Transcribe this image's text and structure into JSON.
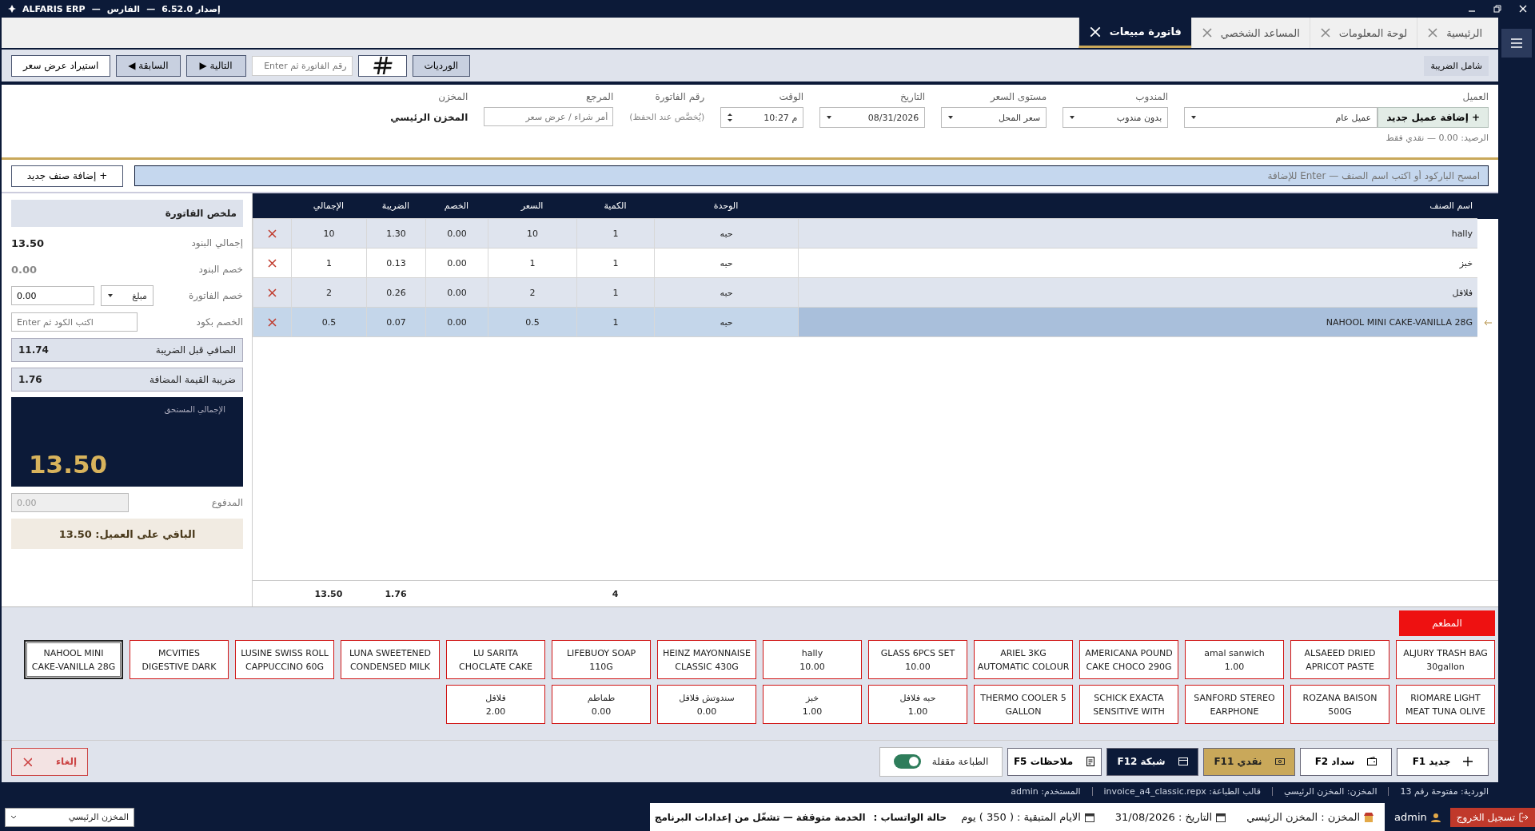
{
  "title_bar": {
    "title_parts": [
      "إصدار 6.52.0",
      "—",
      "الفارس",
      "—",
      "ALFARIS ERP"
    ]
  },
  "tabs": [
    {
      "label": "الرئيسية",
      "selected": false
    },
    {
      "label": "لوحة المعلومات",
      "selected": false
    },
    {
      "label": "المساعد الشخصي",
      "selected": false
    },
    {
      "label": "فاتورة مبيعات",
      "selected": true
    }
  ],
  "toolbar": {
    "tax_inclusive": "شامل الضريبة",
    "shifts": "الورديات",
    "invoice_search_placeholder": "رقم الفاتورة ثم Enter",
    "next": {
      "label": "التالية",
      "glyph": "▶"
    },
    "previous": {
      "label": "السابقة",
      "glyph": "◀"
    },
    "import_quote": "استيراد عرض سعر"
  },
  "form": {
    "customer": {
      "label": "العميل",
      "add_button": "+ إضافة عميل جديد",
      "value": "عميل عام",
      "balance": "الرصيد: 0.00 — نقدي فقط"
    },
    "fields": [
      {
        "kind": "select",
        "label": "المندوب",
        "value": "بدون مندوب"
      },
      {
        "kind": "select",
        "label": "مستوى السعر",
        "value": "سعر المحل"
      },
      {
        "kind": "select",
        "label": "التاريخ",
        "value": "08/31/2026"
      },
      {
        "kind": "spinner",
        "label": "الوقت",
        "value": "10:27 م"
      },
      {
        "kind": "note",
        "label": "رقم الفاتورة",
        "value": "(يُخصَّص عند الحفظ)"
      },
      {
        "kind": "input",
        "label": "المرجع",
        "placeholder": "أمر شراء / عرض سعر"
      },
      {
        "kind": "text",
        "label": "المخزن",
        "value": "المخزن الرئيسي"
      }
    ]
  },
  "search": {
    "placeholder": "امسح الباركود أو اكتب اسم الصنف — Enter للإضافة",
    "add_item": "+ إضافة صنف جديد"
  },
  "table": {
    "columns": [
      "اسم الصنف",
      "الوحدة",
      "الكمية",
      "السعر",
      "الخصم",
      "الضريبة",
      "الإجمالي"
    ],
    "rows": [
      {
        "cells": [
          "hally",
          "حبه",
          "1",
          "10",
          "0.00",
          "1.30",
          "10"
        ],
        "selected": false
      },
      {
        "cells": [
          "خبز",
          "حبه",
          "1",
          "1",
          "0.00",
          "0.13",
          "1"
        ],
        "selected": false
      },
      {
        "cells": [
          "فلافل",
          "حبه",
          "1",
          "2",
          "0.00",
          "0.26",
          "2"
        ],
        "selected": false
      },
      {
        "cells": [
          "NAHOOL MINI CAKE-VANILLA 28G",
          "حبه",
          "1",
          "0.5",
          "0.00",
          "0.07",
          "0.5"
        ],
        "selected": true
      }
    ],
    "totals": {
      "quantity": "4",
      "tax": "1.76",
      "total": "13.50"
    }
  },
  "summary": {
    "title": "ملخص الفاتورة",
    "lines": [
      {
        "kind": "value",
        "label": "إجمالي البنود",
        "value": "13.50"
      },
      {
        "kind": "muted",
        "label": "خصم البنود",
        "value": "0.00"
      },
      {
        "kind": "discount",
        "label": "خصم الفاتورة",
        "type": "مبلغ",
        "value": "0.00"
      },
      {
        "kind": "code",
        "label": "الخصم بكود",
        "placeholder": "اكتب الكود ثم Enter"
      },
      {
        "kind": "boxed",
        "label": "الصافي قبل الضريبة",
        "value": "11.74"
      },
      {
        "kind": "boxed",
        "label": "ضريبة القيمة المضافة",
        "value": "1.76"
      },
      {
        "kind": "grand",
        "label": "الإجمالي المستحق",
        "value": "13.50"
      },
      {
        "kind": "paid",
        "label": "المدفوع",
        "value": "0.00"
      },
      {
        "kind": "remaining",
        "label": "الباقي على العميل: 13.50"
      }
    ]
  },
  "products": {
    "category": "المطعم",
    "items": [
      {
        "lines": [
          "ALJURY TRASH BAG",
          "30gallon"
        ],
        "selected": false
      },
      {
        "lines": [
          "ALSAEED DRIED",
          "APRICOT PASTE"
        ],
        "selected": false
      },
      {
        "lines": [
          "amal sanwich",
          "1.00"
        ],
        "selected": false
      },
      {
        "lines": [
          "AMERICANA POUND",
          "CAKE CHOCO 290G"
        ],
        "selected": false
      },
      {
        "lines": [
          "ARIEL 3KG",
          "AUTOMATIC COLOUR"
        ],
        "selected": false
      },
      {
        "lines": [
          "GLASS 6PCS SET",
          "10.00"
        ],
        "selected": false
      },
      {
        "lines": [
          "hally",
          "10.00"
        ],
        "selected": false
      },
      {
        "lines": [
          "HEINZ MAYONNAISE",
          "CLASSIC 430G"
        ],
        "selected": false
      },
      {
        "lines": [
          "LIFEBUOY SOAP",
          "110G"
        ],
        "selected": false
      },
      {
        "lines": [
          "LU SARITA",
          "CHOCLATE CAKE"
        ],
        "selected": false
      },
      {
        "lines": [
          "LUNA SWEETENED",
          "CONDENSED MILK"
        ],
        "selected": false
      },
      {
        "lines": [
          "LUSINE SWISS ROLL",
          "CAPPUCCINO 60G"
        ],
        "selected": false
      },
      {
        "lines": [
          "MCVITIES",
          "DIGESTIVE DARK"
        ],
        "selected": false
      },
      {
        "lines": [
          "NAHOOL MINI",
          "CAKE-VANILLA 28G"
        ],
        "selected": true
      },
      {
        "lines": [
          "RIOMARE LIGHT",
          "MEAT TUNA OLIVE"
        ],
        "selected": false
      },
      {
        "lines": [
          "ROZANA BAISON",
          "500G"
        ],
        "selected": false
      },
      {
        "lines": [
          "SANFORD STEREO",
          "EARPHONE"
        ],
        "selected": false
      },
      {
        "lines": [
          "SCHICK EXACTA",
          "SENSITIVE WITH"
        ],
        "selected": false
      },
      {
        "lines": [
          "THERMO COOLER 5",
          "GALLON"
        ],
        "selected": false
      },
      {
        "lines": [
          "حبه فلافل",
          "1.00"
        ],
        "selected": false
      },
      {
        "lines": [
          "خبز",
          "1.00"
        ],
        "selected": false
      },
      {
        "lines": [
          "سندوتش فلافل",
          "0.00"
        ],
        "selected": false
      },
      {
        "lines": [
          "طماطم",
          "0.00"
        ],
        "selected": false
      },
      {
        "lines": [
          "فلافل",
          "2.00"
        ],
        "selected": false
      }
    ]
  },
  "actions": [
    {
      "kind": "new",
      "label": "جديد  F1"
    },
    {
      "kind": "pay",
      "label": "سداد  F2"
    },
    {
      "kind": "cash",
      "label": "نقدي  F11"
    },
    {
      "kind": "card",
      "label": "شبكة  F12"
    },
    {
      "kind": "notes",
      "label": "ملاحظات  F5"
    }
  ],
  "print_toggle": {
    "label": "الطباعة مقفلة",
    "on": true
  },
  "cancel": "إلغاء",
  "status_line": [
    "الوردية: مفتوحة رقم 13",
    "المخزن: المخزن الرئيسي",
    "قالب الطباعة: invoice_a4_classic.repx",
    "المستخدم: admin"
  ],
  "taskbar": {
    "logout": "تسجيل الخروج",
    "user": "admin",
    "store": "المخزن : المخزن الرئيسي",
    "date": "التاريخ : 31/08/2026",
    "days_left": "الايام المتبقية : ( 350 ) يوم",
    "whatsapp_label": "حالة الواتساب :",
    "whatsapp_status": "الخدمة متوقفة — تشغّل من إعدادات البرنامج",
    "warehouse_select": "المخزن الرئيسي"
  }
}
